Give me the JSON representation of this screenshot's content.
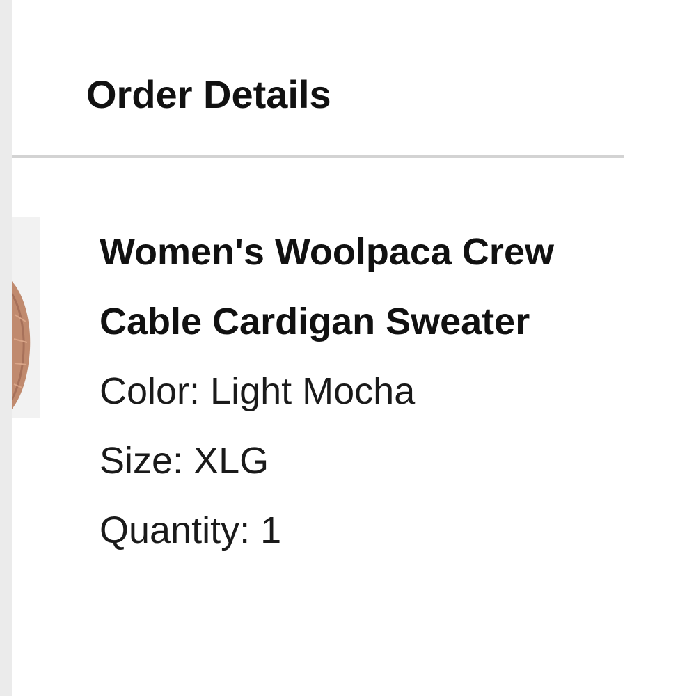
{
  "order": {
    "title": "Order Details"
  },
  "item": {
    "name": "Women's Woolpaca Crew Cable Cardigan Sweater",
    "color_line": "Color: Light Mocha",
    "size_line": "Size: XLG",
    "quantity_line": "Quantity: 1",
    "thumbnail_color": "#c08a6e"
  }
}
